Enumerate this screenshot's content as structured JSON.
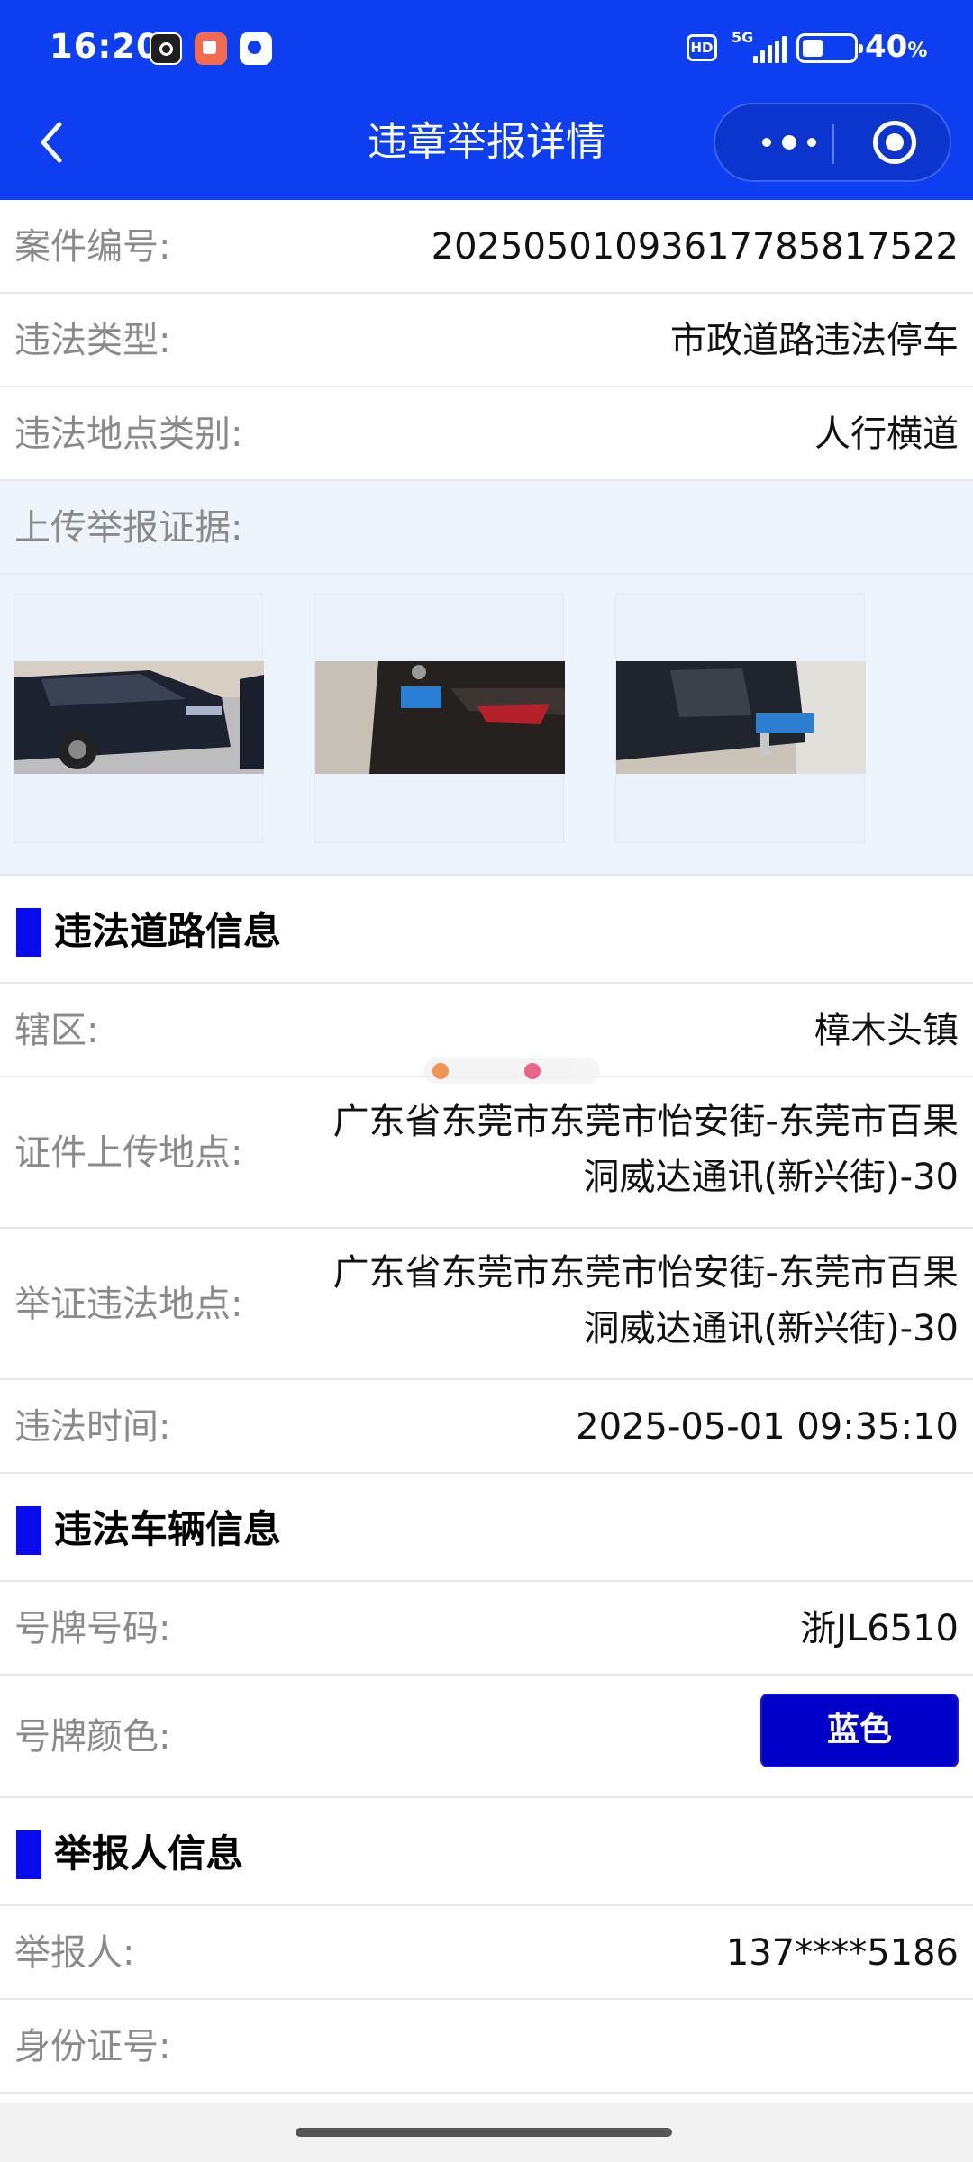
{
  "status_bar": {
    "time": "16:20",
    "hd": "HD",
    "network": "5G",
    "battery_percent": "40",
    "battery_unit": "%",
    "battery_level": 0.4
  },
  "nav": {
    "title": "违章举报详情",
    "back_icon": "chevron-left-icon",
    "more_icon": "more-dots-icon",
    "close_icon": "target-circle-icon"
  },
  "case": {
    "number_label": "案件编号:",
    "number_value": "20250501093617785817522",
    "type_label": "违法类型:",
    "type_value": "市政道路违法停车",
    "location_type_label": "违法地点类别:",
    "location_type_value": "人行横道",
    "evidence_label": "上传举报证据:",
    "evidence_count": 3
  },
  "road_section": {
    "title": "违法道路信息",
    "district_label": "辖区:",
    "district_value": "樟木头镇",
    "upload_location_label": "证件上传地点:",
    "upload_location_value": "广东省东莞市东莞市怡安街-东莞市百果洞威达通讯(新兴街)-30",
    "violation_location_label": "举证违法地点:",
    "violation_location_value": "广东省东莞市东莞市怡安街-东莞市百果洞威达通讯(新兴街)-30",
    "time_label": "违法时间:",
    "time_value": "2025-05-01 09:35:10"
  },
  "vehicle_section": {
    "title": "违法车辆信息",
    "plate_label": "号牌号码:",
    "plate_value": "浙JL6510",
    "plate_color_label": "号牌颜色:",
    "plate_color_value": "蓝色",
    "plate_color_hex": "#0000c8"
  },
  "reporter_section": {
    "title": "举报人信息",
    "reporter_label": "举报人:",
    "reporter_value": "137****5186",
    "id_label": "身份证号:",
    "id_value": ""
  },
  "colors": {
    "header_bg": "#0d3ff0",
    "section_accent": "#0a0cf0",
    "light_row_bg": "#eef4fc"
  }
}
